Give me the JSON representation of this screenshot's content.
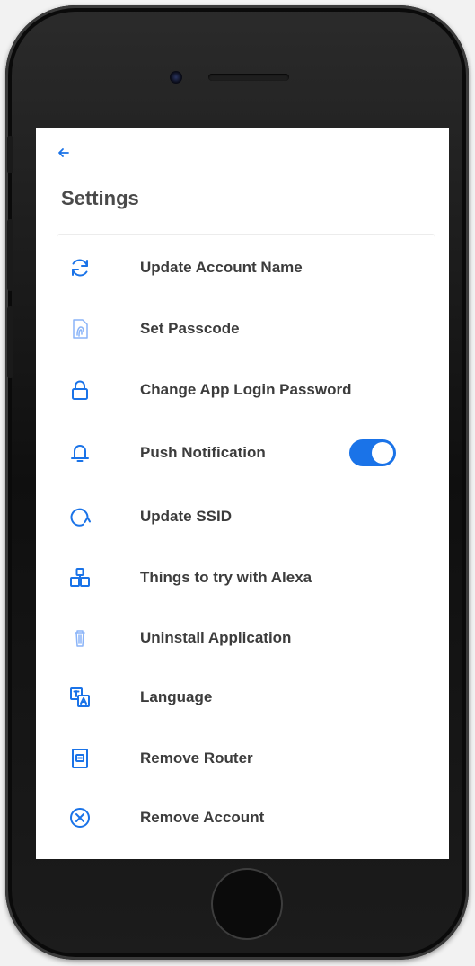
{
  "header": {
    "back_icon": "arrow-left-icon",
    "title": "Settings"
  },
  "settings": {
    "items": [
      {
        "label": "Update Account Name",
        "icon": "refresh-icon"
      },
      {
        "label": "Set Passcode",
        "icon": "fingerprint-document-icon"
      },
      {
        "label": "Change App Login Password",
        "icon": "lock-icon"
      },
      {
        "label": "Push Notification",
        "icon": "bell-icon"
      },
      {
        "label": "Update SSID",
        "icon": "circular-arrow-icon"
      },
      {
        "label": "Things to try with Alexa",
        "icon": "boxes-icon"
      },
      {
        "label": "Uninstall Application",
        "icon": "trash-icon"
      },
      {
        "label": "Language",
        "icon": "translate-icon"
      },
      {
        "label": "Remove Router",
        "icon": "router-icon"
      },
      {
        "label": "Remove Account",
        "icon": "close-circle-icon"
      }
    ],
    "push_notification_enabled": true
  },
  "colors": {
    "accent": "#1a73e8",
    "text": "#3c3c3c",
    "title": "#4a4a4a"
  }
}
